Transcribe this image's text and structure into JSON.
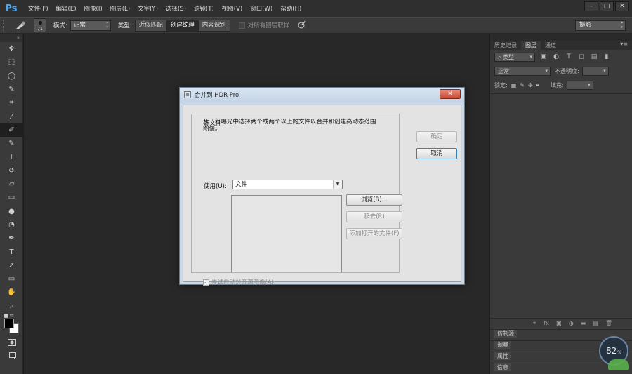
{
  "app": {
    "logo": "Ps"
  },
  "menu": [
    "文件(F)",
    "编辑(E)",
    "图像(I)",
    "图层(L)",
    "文字(Y)",
    "选择(S)",
    "滤镜(T)",
    "视图(V)",
    "窗口(W)",
    "帮助(H)"
  ],
  "window_buttons": {
    "minimize": "–",
    "maximize": "□",
    "close": "✕"
  },
  "options_bar": {
    "brush_size": "71",
    "mode_label": "模式:",
    "mode_value": "正常",
    "type_label": "类型:",
    "type_options": [
      "近似匹配",
      "创建纹理",
      "内容识别"
    ],
    "type_selected_index": 1,
    "sample_all_layers": "对所有图层取样",
    "workspace": "摄影"
  },
  "tools": [
    "move-tool",
    "marquee-tool",
    "lasso-tool",
    "quick-select-tool",
    "crop-tool",
    "eyedropper-tool",
    "spot-healing-tool",
    "brush-tool",
    "clone-stamp-tool",
    "history-brush-tool",
    "eraser-tool",
    "gradient-tool",
    "blur-tool",
    "dodge-tool",
    "pen-tool",
    "type-tool",
    "path-select-tool",
    "shape-tool",
    "hand-tool",
    "zoom-tool"
  ],
  "selected_tool_index": 6,
  "right_panel": {
    "tabs": [
      "历史记录",
      "图层",
      "通道"
    ],
    "active_tab_index": 1,
    "filter_label": "类型",
    "blend_mode": "正常",
    "opacity_label": "不透明度:",
    "lock_label": "锁定:",
    "fill_label": "填充:",
    "collapsed_panels": [
      "仿制源",
      "调整",
      "属性",
      "信息"
    ]
  },
  "dialog": {
    "title": "合并到 HDR Pro",
    "group_label": "源文件",
    "description": "从一组曝光中选择两个或两个以上的文件以合并和创建高动态范围图像。",
    "use_label": "使用(U):",
    "use_value": "文件",
    "buttons": {
      "browse": "浏览(B)...",
      "remove": "移去(R)",
      "add_open": "添加打开的文件(F)",
      "ok": "确定",
      "cancel": "取消"
    },
    "align_checkbox": "尝试自动对齐源图像(A)",
    "align_checked": true
  },
  "meter": {
    "value": "82",
    "unit": "%"
  }
}
